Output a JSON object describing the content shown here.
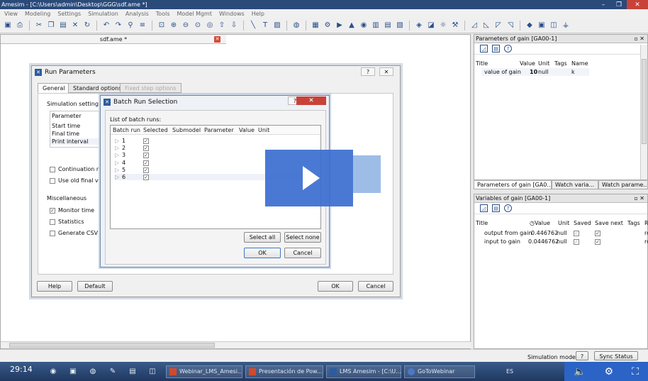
{
  "app": {
    "title": "Amesim - [C:\\Users\\admin\\Desktop\\GGG\\sdf.ame *]"
  },
  "menu": [
    "View",
    "Modeling",
    "Settings",
    "Simulation",
    "Analysis",
    "Tools",
    "Model Mgmt",
    "Windows",
    "Help"
  ],
  "document": {
    "tab": "sdf.ame *"
  },
  "run_params": {
    "title": "Run Parameters",
    "tabs": [
      "General",
      "Standard options",
      "Fixed step options"
    ],
    "sim_group": "Simulation settings",
    "param_header": "Parameter",
    "params": [
      "Start time",
      "Final time",
      "Print interval"
    ],
    "cont_run": "Continuation run",
    "old_final": "Use old final values",
    "misc_group": "Miscellaneous",
    "monitor": "Monitor time",
    "statistics": "Statistics",
    "csv": "Generate CSV",
    "help": "Help",
    "default": "Default",
    "ok": "OK",
    "cancel": "Cancel"
  },
  "batch": {
    "title": "Batch Run Selection",
    "list_label": "List of batch runs:",
    "columns": [
      "Batch run",
      "Selected",
      "Submodel",
      "Parameter",
      "Value",
      "Unit"
    ],
    "rows": [
      "1",
      "2",
      "3",
      "4",
      "5",
      "6"
    ],
    "select_all": "Select all",
    "select_none": "Select none",
    "ok": "OK",
    "cancel": "Cancel"
  },
  "params_panel": {
    "title": "Parameters of gain [GA00-1]",
    "columns": [
      "Title",
      "Value",
      "Unit",
      "Tags",
      "Name"
    ],
    "row": {
      "title": "value of gain",
      "value": "10",
      "unit": "null",
      "name": "k"
    },
    "tabs": [
      "Parameters of gain [GA0...",
      "Watch varia...",
      "Watch parame..."
    ]
  },
  "vars_panel": {
    "title": "Variables of gain [GA00-1]",
    "columns": [
      "Title",
      "Value",
      "Unit",
      "Saved",
      "Save next",
      "Tags",
      "R"
    ],
    "rows": [
      {
        "title": "output from gain",
        "value": "0.446762",
        "unit": "null",
        "r": "re"
      },
      {
        "title": "input to gain",
        "value": "0.0446762",
        "unit": "null",
        "r": "re"
      }
    ]
  },
  "status": {
    "mode": "Simulation mode",
    "sync": "Sync Status"
  },
  "taskbar": {
    "items": [
      "Webinar_LMS_Amesi...",
      "Presentación de Pow...",
      "LMS Amesim - [C:\\U...",
      "GoToWebinar"
    ],
    "lang": "ES"
  },
  "video": {
    "time": "29:14"
  }
}
